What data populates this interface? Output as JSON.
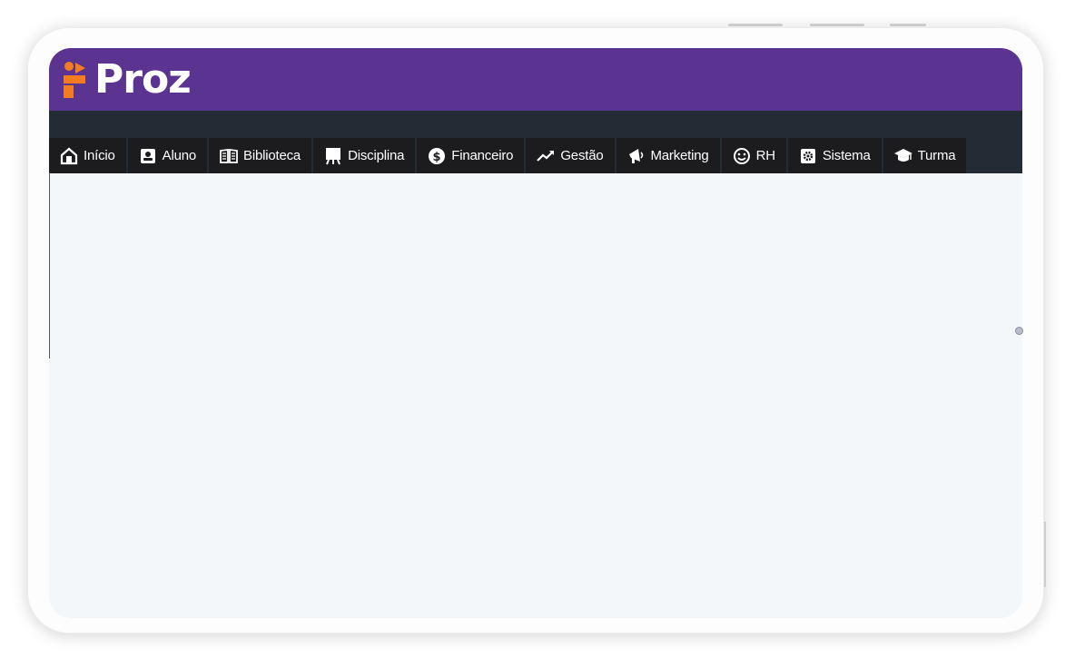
{
  "brand": {
    "name": "Proz",
    "logo_color": "#f47c20",
    "header_color": "#5b3491"
  },
  "nav": {
    "items": [
      {
        "label": "Início",
        "icon": "home-icon"
      },
      {
        "label": "Aluno",
        "icon": "id-card-icon"
      },
      {
        "label": "Biblioteca",
        "icon": "book-open-icon"
      },
      {
        "label": "Disciplina",
        "icon": "chalkboard-icon"
      },
      {
        "label": "Financeiro",
        "icon": "dollar-circle-icon"
      },
      {
        "label": "Gestão",
        "icon": "trend-up-icon"
      },
      {
        "label": "Marketing",
        "icon": "megaphone-icon"
      },
      {
        "label": "RH",
        "icon": "smile-icon"
      },
      {
        "label": "Sistema",
        "icon": "cog-icon"
      },
      {
        "label": "Turma",
        "icon": "graduation-cap-icon"
      }
    ]
  }
}
